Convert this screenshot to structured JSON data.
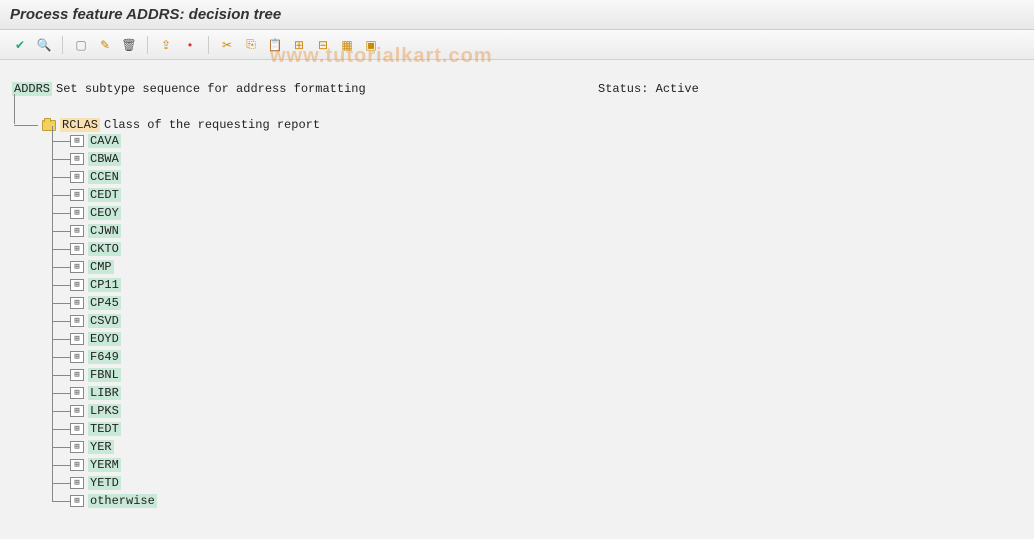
{
  "header": {
    "title": "Process feature ADDRS: decision tree"
  },
  "toolbar": {
    "icons": [
      {
        "name": "check-icon",
        "glyph": "✔",
        "color": "#2a7"
      },
      {
        "name": "search-icon",
        "glyph": "🔍",
        "color": "#36c"
      },
      {
        "sep": true
      },
      {
        "name": "create-icon",
        "glyph": "▢",
        "color": "#888"
      },
      {
        "name": "edit-icon",
        "glyph": "✎",
        "color": "#c80"
      },
      {
        "name": "delete-icon",
        "glyph": "🗑",
        "color": "#555"
      },
      {
        "sep": true
      },
      {
        "name": "hierarchy-icon",
        "glyph": "⇪",
        "color": "#c80"
      },
      {
        "name": "pin-icon",
        "glyph": "•",
        "color": "#d33"
      },
      {
        "sep": true
      },
      {
        "name": "cut-icon",
        "glyph": "✂",
        "color": "#c80"
      },
      {
        "name": "copy-icon",
        "glyph": "⎘",
        "color": "#c80"
      },
      {
        "name": "paste-icon",
        "glyph": "📋",
        "color": "#c80"
      },
      {
        "name": "expand-icon",
        "glyph": "⊞",
        "color": "#c80"
      },
      {
        "name": "collapse-icon",
        "glyph": "⊟",
        "color": "#c80"
      },
      {
        "name": "select-all-icon",
        "glyph": "▦",
        "color": "#c80"
      },
      {
        "name": "deselect-icon",
        "glyph": "▣",
        "color": "#c80"
      }
    ]
  },
  "tree": {
    "root_code": "ADDRS",
    "root_label": "Set subtype sequence for address formatting",
    "status_prefix": "Status:",
    "status_value": "Active",
    "rclas_code": "RCLAS",
    "rclas_label": "Class of the requesting report",
    "children": [
      "CAVA",
      "CBWA",
      "CCEN",
      "CEDT",
      "CEOY",
      "CJWN",
      "CKTO",
      "CMP",
      "CP11",
      "CP45",
      "CSVD",
      "EOYD",
      "F649",
      "FBNL",
      "LIBR",
      "LPKS",
      "TEDT",
      "YER",
      "YERM",
      "YETD",
      "otherwise"
    ]
  },
  "watermark": "www.tutorialkart.com"
}
